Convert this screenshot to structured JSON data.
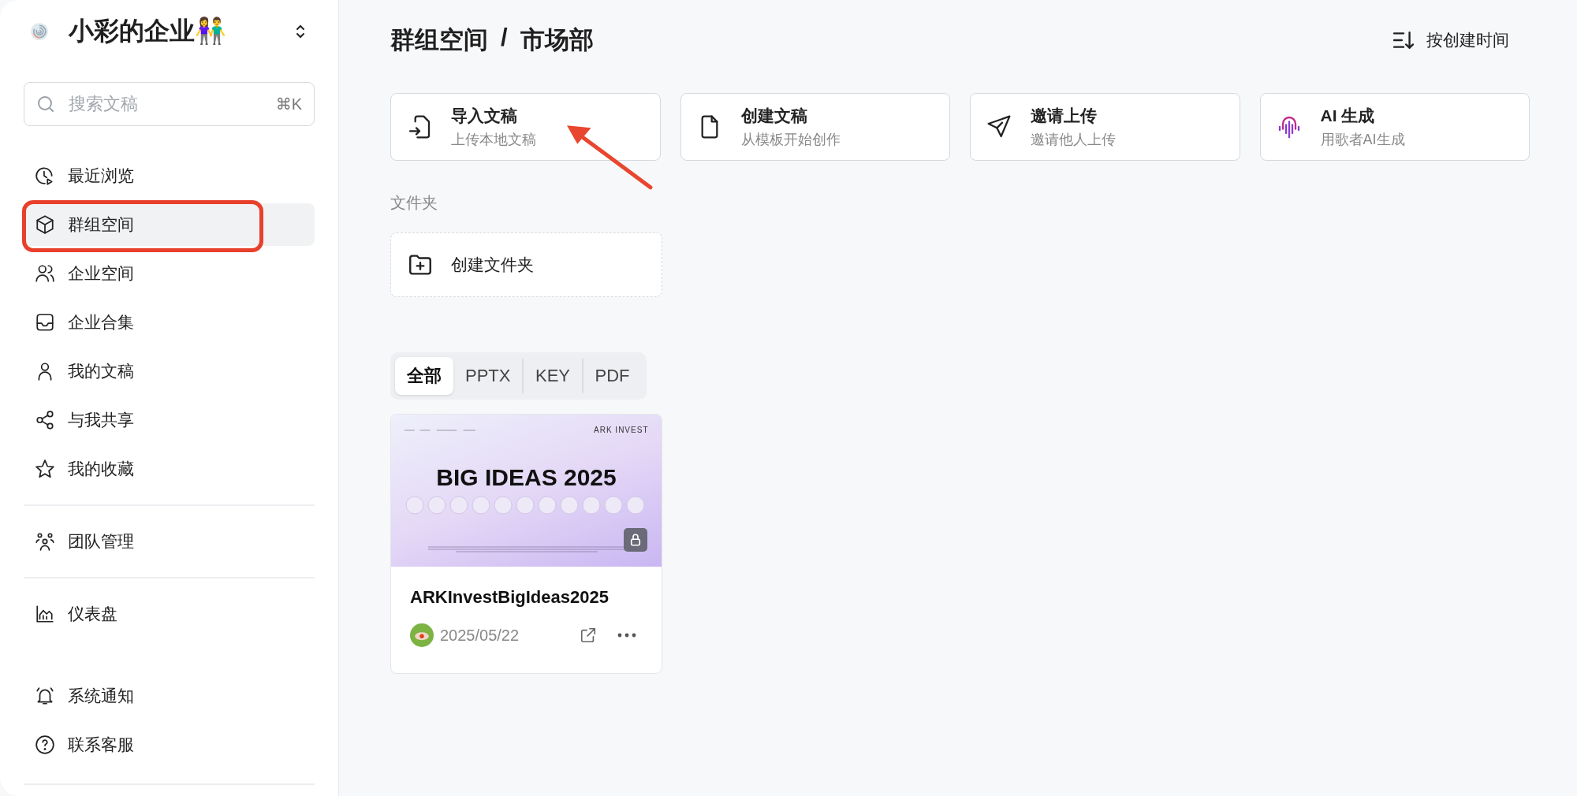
{
  "sidebar": {
    "workspace": {
      "name": "小彩的企业👫"
    },
    "search": {
      "placeholder": "搜索文稿",
      "shortcut": "⌘K"
    },
    "groups": [
      [
        {
          "kind": "recent",
          "label": "最近浏览",
          "selected": false
        },
        {
          "kind": "group",
          "label": "群组空间",
          "selected": true,
          "highlighted": true
        },
        {
          "kind": "company",
          "label": "企业空间",
          "selected": false
        },
        {
          "kind": "collection",
          "label": "企业合集",
          "selected": false
        },
        {
          "kind": "mine",
          "label": "我的文稿",
          "selected": false
        },
        {
          "kind": "shared",
          "label": "与我共享",
          "selected": false
        },
        {
          "kind": "favorite",
          "label": "我的收藏",
          "selected": false
        }
      ],
      [
        {
          "kind": "team",
          "label": "团队管理",
          "selected": false
        }
      ],
      [
        {
          "kind": "dashboard",
          "label": "仪表盘",
          "selected": false
        }
      ],
      [
        {
          "kind": "notify",
          "label": "系统通知",
          "selected": false
        },
        {
          "kind": "support",
          "label": "联系客服",
          "selected": false
        }
      ]
    ]
  },
  "header": {
    "breadcrumb": [
      "群组空间",
      "市场部"
    ],
    "separator": "/",
    "sort": {
      "label": "按创建时间"
    }
  },
  "actions": [
    {
      "kind": "import",
      "title": "导入文稿",
      "subtitle": "上传本地文稿",
      "arrow_pointing": true
    },
    {
      "kind": "create",
      "title": "创建文稿",
      "subtitle": "从模板开始创作"
    },
    {
      "kind": "invite",
      "title": "邀请上传",
      "subtitle": "邀请他人上传"
    },
    {
      "kind": "ai",
      "title": "AI 生成",
      "subtitle": "用歌者AI生成"
    }
  ],
  "folders": {
    "label": "文件夹",
    "create_label": "创建文件夹"
  },
  "filters": [
    {
      "label": "全部",
      "selected": true
    },
    {
      "label": "PPTX",
      "selected": false
    },
    {
      "label": "KEY",
      "selected": false
    },
    {
      "label": "PDF",
      "selected": false
    }
  ],
  "documents": [
    {
      "title": "ARKInvestBigIdeas2025",
      "date": "2025/05/22",
      "locked": true,
      "thumbnail": {
        "brand": "ARK INVEST",
        "headline": "BIG IDEAS 2025"
      }
    }
  ]
}
